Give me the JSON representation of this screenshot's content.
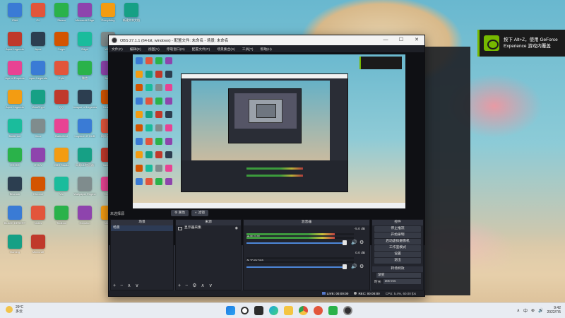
{
  "desktop": {
    "icons": [
      {
        "label": "IObit",
        "icon": "app-icon"
      },
      {
        "label": "GL",
        "icon": "app-icon"
      },
      {
        "label": "Steam",
        "icon": "steam-icon"
      },
      {
        "label": "Microsoft Edge",
        "icon": "edge-icon"
      },
      {
        "label": "Everything",
        "icon": "app-icon"
      },
      {
        "label": "新建文本文档",
        "icon": "file-icon"
      },
      {
        "label": "Apex Legends",
        "icon": "app-icon"
      },
      {
        "label": "Apex",
        "icon": "app-icon"
      },
      {
        "label": "Origin",
        "icon": "app-icon"
      },
      {
        "label": "Edge",
        "icon": "edge-icon"
      },
      {
        "label": "WPS",
        "icon": "wps-icon"
      },
      {
        "label": "Age of Empires",
        "icon": "app-icon"
      },
      {
        "label": "Apex Legends",
        "icon": "app-icon"
      },
      {
        "label": "Epic",
        "icon": "app-icon"
      },
      {
        "label": "微信",
        "icon": "wechat-icon"
      },
      {
        "label": "Apex",
        "icon": "app-icon"
      },
      {
        "label": "Apex Legends",
        "icon": "app-icon"
      },
      {
        "label": "VeraCrypt",
        "icon": "app-icon"
      },
      {
        "label": "QQ",
        "icon": "qq-icon"
      },
      {
        "label": "League of Legends",
        "icon": "app-icon"
      },
      {
        "label": "League",
        "icon": "app-icon"
      },
      {
        "label": "Battle.net",
        "icon": "app-icon"
      },
      {
        "label": "Xbox",
        "icon": "xbox-icon"
      },
      {
        "label": "Battlefield",
        "icon": "app-icon"
      },
      {
        "label": "Logitech G HUB",
        "icon": "app-icon"
      },
      {
        "label": "网易云音乐",
        "icon": "app-icon"
      },
      {
        "label": "CS:GO",
        "icon": "app-icon"
      },
      {
        "label": "GTA V",
        "icon": "app-icon"
      },
      {
        "label": "OBS Studio",
        "icon": "obs-icon"
      },
      {
        "label": "网易UU加速器",
        "icon": "app-icon"
      },
      {
        "label": "Valorant",
        "icon": "app-icon"
      },
      {
        "label": "Bitcrush",
        "icon": "app-icon"
      },
      {
        "label": "Chrome",
        "icon": "chrome-icon"
      },
      {
        "label": "Vlc",
        "icon": "app-icon"
      },
      {
        "label": "Wallpaper Engine",
        "icon": "app-icon"
      },
      {
        "label": "DLSS",
        "icon": "app-icon"
      },
      {
        "label": "BLACK DESERT",
        "icon": "app-icon"
      },
      {
        "label": "Notes",
        "icon": "app-icon"
      },
      {
        "label": "Toolbox",
        "icon": "app-icon"
      },
      {
        "label": "Genshin",
        "icon": "app-icon"
      },
      {
        "label": "Maps",
        "icon": "app-icon"
      },
      {
        "label": "Gaming",
        "icon": "app-icon"
      },
      {
        "label": "Minecraft",
        "icon": "app-icon"
      }
    ]
  },
  "geforce_toast": {
    "line1": "按下 Alt+Z，使用 GeForce",
    "line2": "Experience 游戏内覆盖"
  },
  "obs": {
    "title": "OBS 27.1.1 (64-bit, windows) - 配置文件: 未命名 - 场景: 未命名",
    "window_buttons": {
      "minimize": "—",
      "maximize": "☐",
      "close": "✕"
    },
    "menu": [
      "文件(F)",
      "编辑(E)",
      "视图(V)",
      "停靠窗口(D)",
      "配置文件(P)",
      "场景集合(S)",
      "工具(T)",
      "帮助(H)"
    ],
    "scene_label": "未选择源",
    "scene_props": [
      "属性",
      "滤镜"
    ],
    "docks": {
      "scenes": {
        "title": "场景",
        "items": [
          "场景"
        ]
      },
      "sources": {
        "title": "来源",
        "items": [
          "显示器采集"
        ]
      },
      "mixer": {
        "title": "混音器",
        "tracks": [
          {
            "name": "桌面音频",
            "db": "-5.0 dB",
            "level": 0.82
          },
          {
            "name": "麦克风/Aux",
            "db": "0.0 dB",
            "level": 0.0
          }
        ]
      },
      "controls": {
        "title": "控件",
        "buttons": [
          "停止推流",
          "开始录制",
          "启动虚拟摄像机",
          "工作室模式",
          "设置",
          "退出"
        ],
        "transitions_title": "转场特效",
        "transition_label": "渐变",
        "duration_label": "时长",
        "duration_value": "300 ms"
      }
    },
    "dock_footer": {
      "add": "+",
      "remove": "−",
      "gear": "⚙",
      "up": "∧",
      "down": "∨"
    },
    "status": {
      "live_label": "LIVE:",
      "live_time": "00:00:00",
      "rec_label": "REC:",
      "rec_time": "00:00:00",
      "cpu": "CPU: 5.4%, 60.00 fps"
    }
  },
  "taskbar": {
    "weather_temp": "29°C",
    "weather_desc": "多云",
    "clock_time": "9:42",
    "clock_date": "2022/7/5",
    "tray_symbols": [
      "∧",
      "中",
      "⊕",
      "🔊"
    ]
  },
  "colors": {
    "obs_bg": "#2b2e38",
    "accent_blue": "#4d86d8",
    "nvidia_green": "#76b900"
  }
}
